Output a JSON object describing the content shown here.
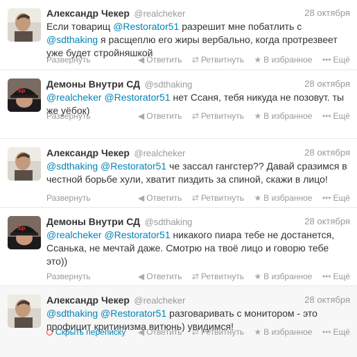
{
  "tweets": [
    {
      "fullname": "Александр Чекер",
      "username": "@realcheker",
      "date": "28 октября",
      "text_pre": "Если товарищ ",
      "mention1": "@Restorator51",
      "text_mid": " разрешит мне побатлить с ",
      "mention2": "@sdthaking",
      "text_post": " я расщеплю его жиры вербально, когда протрезвеет уже будет стройняшкой",
      "expand": "Развернуть",
      "avatar": "person-avatar"
    },
    {
      "fullname": "Демоны Внутри СД",
      "username": "@sdthaking",
      "date": "28 октября",
      "mention1": "@realcheker",
      "mention2": "@Restorator51",
      "text_post": " нет Ссаня, тебя никуда не позовут. ты же уёбок)",
      "expand": "Развернуть",
      "avatar": "cap-avatar"
    },
    {
      "fullname": "Александр Чекер",
      "username": "@realcheker",
      "date": "28 октября",
      "mention1": "@sdthaking",
      "mention2": "@Restorator51",
      "text_post": " че зассал гангстер?? Давай сразимся в честной борьбе хули, хватит пиздить за спиной, скажи в лицо!",
      "expand": "Развернуть",
      "avatar": "person-avatar"
    },
    {
      "fullname": "Демоны Внутри СД",
      "username": "@sdthaking",
      "date": "28 октября",
      "mention1": "@realcheker",
      "mention2": "@Restorator51",
      "text_post": " никакого пиара тебе не достанется, Ссанька, не мечтай даже. Смотрю на твоё лицо и говорю тебе это))",
      "expand": "Развернуть",
      "avatar": "cap-avatar"
    },
    {
      "fullname": "Александр Чекер",
      "username": "@realcheker",
      "date": "28 октября",
      "mention1": "@sdthaking",
      "mention2": "@Restorator51",
      "text_post": " разговаривать с монитором - это профицит критинизма витюнь) увидимся!",
      "expand": "Скрыть переписку",
      "avatar": "person-avatar"
    }
  ],
  "actions": {
    "reply": "Ответить",
    "retweet": "Ретвитнуть",
    "favorite": "В избранное",
    "more": "Ещё"
  },
  "icons": {
    "reply": "reply-arrow-icon",
    "retweet": "retweet-icon",
    "favorite": "star-icon",
    "more": "dots-icon",
    "conversation": "conversation-icon"
  },
  "colors": {
    "mention": "#0084b4",
    "meta": "#999999",
    "conversation_icon": "#dd3333"
  }
}
